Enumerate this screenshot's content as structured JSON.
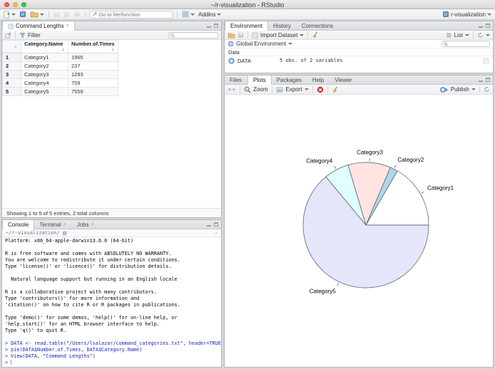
{
  "window": {
    "title": "~/r-visualization - RStudio",
    "project_label": "r-visualization"
  },
  "main_toolbar": {
    "goto_placeholder": "Go to file/function",
    "addins_label": "Addins"
  },
  "data_viewer": {
    "tab_label": "Command Lengths",
    "filter_label": "Filter",
    "columns": [
      "Category.Name",
      "Number.of.Times"
    ],
    "rows": [
      {
        "num": "1",
        "name": "Category1",
        "value": "1965"
      },
      {
        "num": "2",
        "name": "Category2",
        "value": "237"
      },
      {
        "num": "3",
        "name": "Category3",
        "value": "1293"
      },
      {
        "num": "4",
        "name": "Category4",
        "value": "759"
      },
      {
        "num": "5",
        "name": "Category5",
        "value": "7559"
      }
    ],
    "footer": "Showing 1 to 5 of 5 entries, 2 total columns"
  },
  "console": {
    "tabs": [
      "Console",
      "Terminal",
      "Jobs"
    ],
    "working_dir": "~/r-visualization/",
    "output_lines": [
      "Platform: x86_64-apple-darwin13.6.0 (64-bit)",
      "",
      "R is free software and comes with ABSOLUTELY NO WARRANTY.",
      "You are welcome to redistribute it under certain conditions.",
      "Type 'license()' or 'licence()' for distribution details.",
      "",
      "  Natural language support but running in an English locale",
      "",
      "R is a collaborative project with many contributors.",
      "Type 'contributors()' for more information and",
      "'citation()' on how to cite R or R packages in publications.",
      "",
      "Type 'demo()' for some demos, 'help()' for on-line help, or",
      "'help.start()' for an HTML browser interface to help.",
      "Type 'q()' to quit R.",
      ""
    ],
    "commands": [
      "DATA <- read.table(\"/Users/lsalazar/command_categories.txt\", header=TRUE)",
      "pie(DATA$Number.of.Times, DATA$Category.Name)",
      "View(DATA, \"Command Lengths\")"
    ],
    "prompt": ">"
  },
  "environment": {
    "tabs": [
      "Environment",
      "History",
      "Connections"
    ],
    "import_dataset_label": "Import Dataset",
    "list_label": "List",
    "scope_label": "Global Environment",
    "section_label": "Data",
    "objects": [
      {
        "name": "DATA",
        "summary": "5 obs. of 2 variables"
      }
    ]
  },
  "plots_pane": {
    "tabs": [
      "Files",
      "Plots",
      "Packages",
      "Help",
      "Viewer"
    ],
    "zoom_label": "Zoom",
    "export_label": "Export",
    "publish_label": "Publish"
  },
  "chart_data": {
    "type": "pie",
    "categories": [
      "Category1",
      "Category2",
      "Category3",
      "Category4",
      "Category5"
    ],
    "values": [
      1965,
      237,
      1293,
      759,
      7559
    ],
    "colors": [
      "#FFFFFF",
      "#ADD8E6",
      "#FFE4E1",
      "#E0FFFF",
      "#E6E6FA"
    ],
    "edge_color": "#50506a",
    "label_color": "#000000",
    "start_angle_deg": 0,
    "direction": "counterclockwise",
    "legend": "none"
  }
}
